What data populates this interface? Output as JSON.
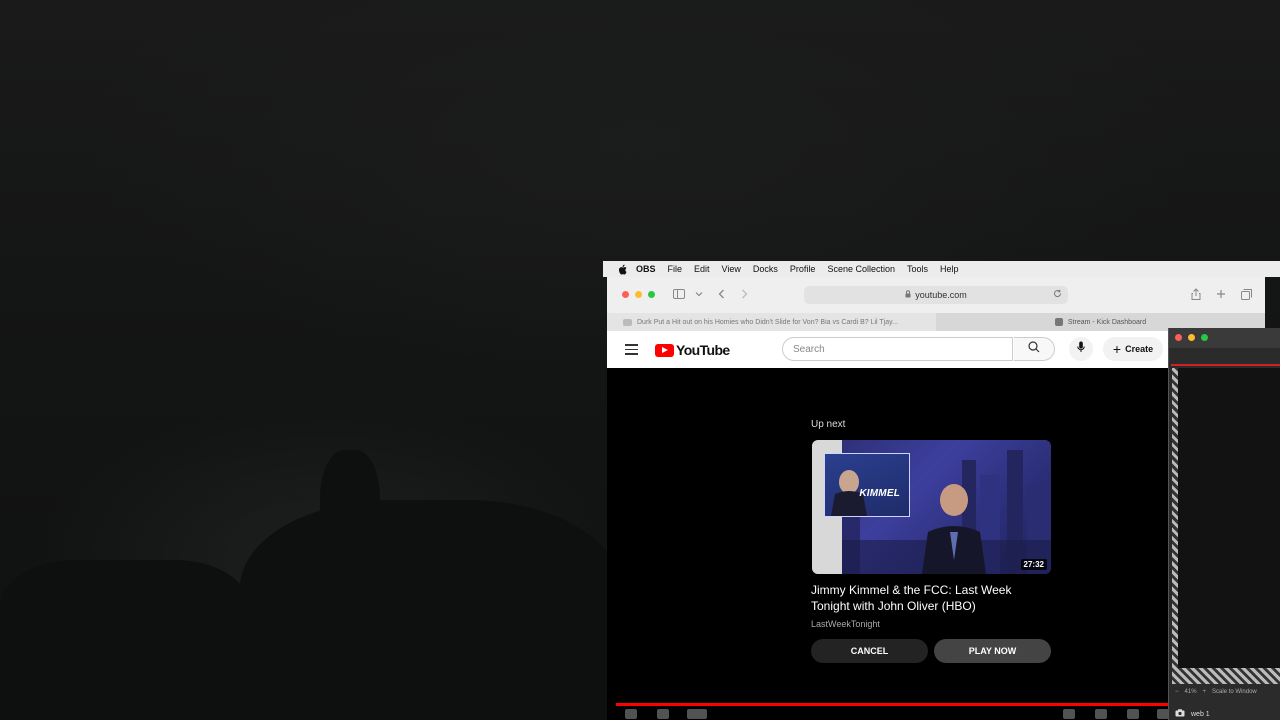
{
  "colors": {
    "youtube_red": "#ff0000",
    "mac_close": "#ff5f57",
    "mac_minimize": "#febc2e",
    "mac_zoom": "#28c840"
  },
  "menubar": {
    "app": "OBS",
    "items": [
      "File",
      "Edit",
      "View",
      "Docks",
      "Profile",
      "Scene Collection",
      "Tools",
      "Help"
    ],
    "icon": "apple-icon"
  },
  "browser": {
    "url": "youtube.com",
    "tabs": [
      {
        "label": "Durk Put a Hit out on his Homies who Didn't Slide for Von? Bia vs Cardi B? Lil Tjay...",
        "active": false
      },
      {
        "label": "Stream - Kick Dashboard",
        "active": true
      }
    ]
  },
  "youtube": {
    "logo_text": "YouTube",
    "search_placeholder": "Search",
    "create_label": "Create"
  },
  "upnext": {
    "label": "Up next",
    "thumbnail_text": "KIMMEL",
    "duration": "27:32",
    "title": "Jimmy Kimmel & the FCC: Last Week Tonight with John Oliver (HBO)",
    "channel": "LastWeekTonight",
    "cancel_label": "CANCEL",
    "play_label": "PLAY NOW"
  },
  "obs": {
    "zoom": "41%",
    "scale_label": "Scale to Window",
    "source_label": "web 1"
  }
}
